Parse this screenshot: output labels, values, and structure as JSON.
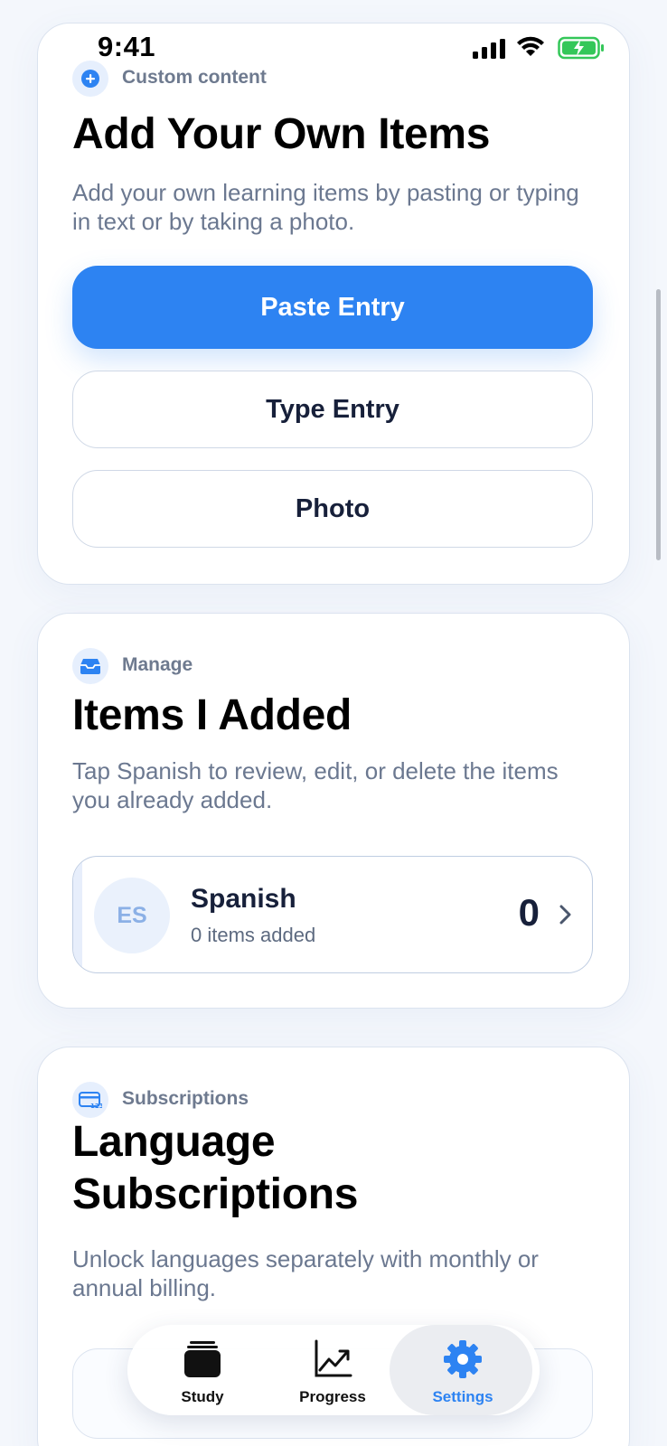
{
  "status_bar": {
    "time": "9:41"
  },
  "custom_content": {
    "eyebrow": "Custom content",
    "title": "Add Your Own Items",
    "description": "Add your own learning items by pasting or typing in text or by taking a photo.",
    "paste_label": "Paste Entry",
    "type_label": "Type Entry",
    "photo_label": "Photo"
  },
  "manage": {
    "eyebrow": "Manage",
    "title": "Items I Added",
    "description": "Tap Spanish to review, edit, or delete the items you already added.",
    "language": {
      "code": "ES",
      "name": "Spanish",
      "subtitle": "0 items added",
      "count": "0"
    }
  },
  "subscriptions": {
    "eyebrow": "Subscriptions",
    "title_line1": "Language",
    "title_line2": "Subscriptions",
    "description": "Unlock languages separately with monthly or annual billing."
  },
  "tabbar": {
    "tabs": [
      {
        "label": "Study",
        "icon": "cards-stack-icon"
      },
      {
        "label": "Progress",
        "icon": "chart-line-icon"
      },
      {
        "label": "Settings",
        "icon": "gear-icon"
      }
    ],
    "active": "Settings"
  },
  "colors": {
    "accent": "#2d83f2",
    "text_primary": "#0f1526",
    "text_secondary": "#6b7890"
  }
}
